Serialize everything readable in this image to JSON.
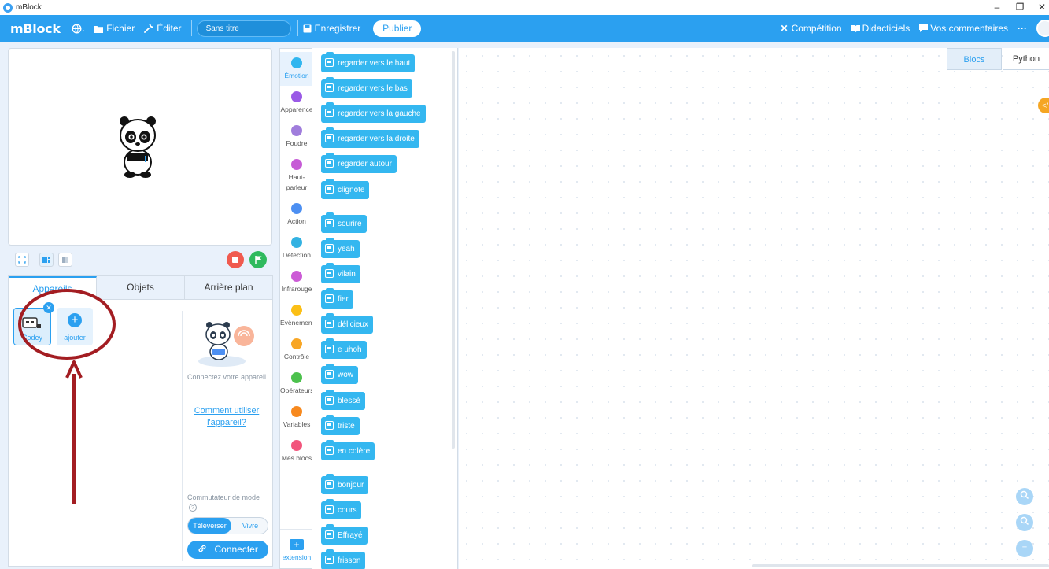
{
  "window": {
    "title": "mBlock",
    "controls": [
      "–",
      "❐",
      "✕"
    ]
  },
  "topbar": {
    "logo": "mBlock",
    "menu": [
      {
        "icon": "globe-icon",
        "label": ""
      },
      {
        "icon": "folder-icon",
        "label": "Fichier"
      },
      {
        "icon": "wrench-icon",
        "label": "Éditer"
      }
    ],
    "project_title": "Sans titre",
    "save_label": "Enregistrer",
    "publish_label": "Publier",
    "right": {
      "competition": "Compétition",
      "tutorials": "Didacticiels",
      "feedback": "Vos commentaires",
      "more": "···"
    }
  },
  "sprite_panel": {
    "tabs": [
      "Appareils",
      "Objets",
      "Arrière plan"
    ],
    "active_tab": "Appareils",
    "device_label": "Codey",
    "add_label": "ajouter",
    "connect_text": "Connectez votre appareil",
    "howto_link": "Comment utiliser l'appareil?",
    "mode_label": "Commutateur de mode",
    "mode_help": "?",
    "mode_options": [
      "Téléverser",
      "Vivre"
    ],
    "connect_button": "Connecter"
  },
  "categories": [
    {
      "label": "Émotion",
      "color": "#31b6ef",
      "active": true
    },
    {
      "label": "Apparence",
      "color": "#9a5ae6"
    },
    {
      "label": "Foudre",
      "color": "#a07ddc"
    },
    {
      "label": "Haut-parleur",
      "color": "#c65bd6"
    },
    {
      "label": "Action",
      "color": "#4c8ff2"
    },
    {
      "label": "Détection",
      "color": "#33b2e2"
    },
    {
      "label": "Infrarouge",
      "color": "#cc5bd6"
    },
    {
      "label": "Évènements",
      "color": "#fbbf16"
    },
    {
      "label": "Contrôle",
      "color": "#f8a625"
    },
    {
      "label": "Opérateurs",
      "color": "#4cc14d"
    },
    {
      "label": "Variables",
      "color": "#f7891e"
    },
    {
      "label": "Mes blocs",
      "color": "#f2557c"
    }
  ],
  "extension_label": "extension",
  "blocks": [
    "regarder vers le haut",
    "regarder vers le bas",
    "regarder vers la gauche",
    "regarder vers la droite",
    "regarder autour",
    "clignote",
    "sourire",
    "yeah",
    "vilain",
    "fier",
    "délicieux",
    "e uhoh",
    "wow",
    "blessé",
    "triste",
    "en colère",
    "bonjour",
    "cours",
    "Effrayé",
    "frisson"
  ],
  "script_area": {
    "tabs": [
      "Blocs",
      "Python"
    ],
    "active_tab": "Blocs",
    "code_toggle": "</",
    "zoom_in": "+",
    "zoom_out": "−",
    "zoom_reset": "="
  },
  "colors": {
    "brand": "#2ba0f0",
    "block": "#34b7f0",
    "stop": "#f05a4f",
    "go": "#2fba5e",
    "annotation": "#a31d22"
  }
}
